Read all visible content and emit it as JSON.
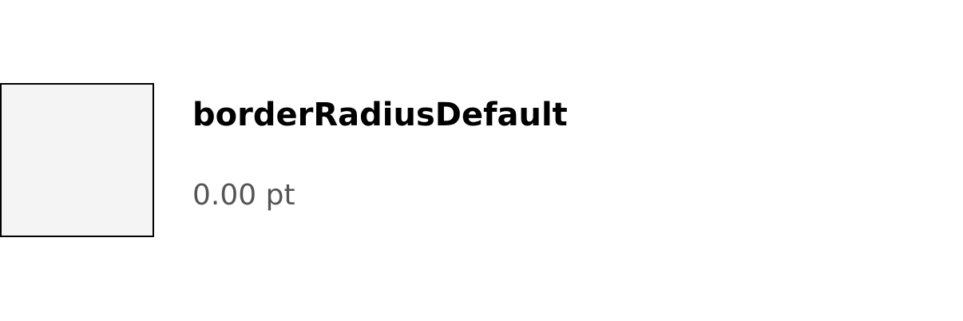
{
  "token": {
    "name": "borderRadiusDefault",
    "value": "0.00 pt"
  },
  "colors": {
    "swatch_fill": "#f4f4f4",
    "swatch_border": "#000000",
    "name_text": "#000000",
    "value_text": "#555555"
  }
}
